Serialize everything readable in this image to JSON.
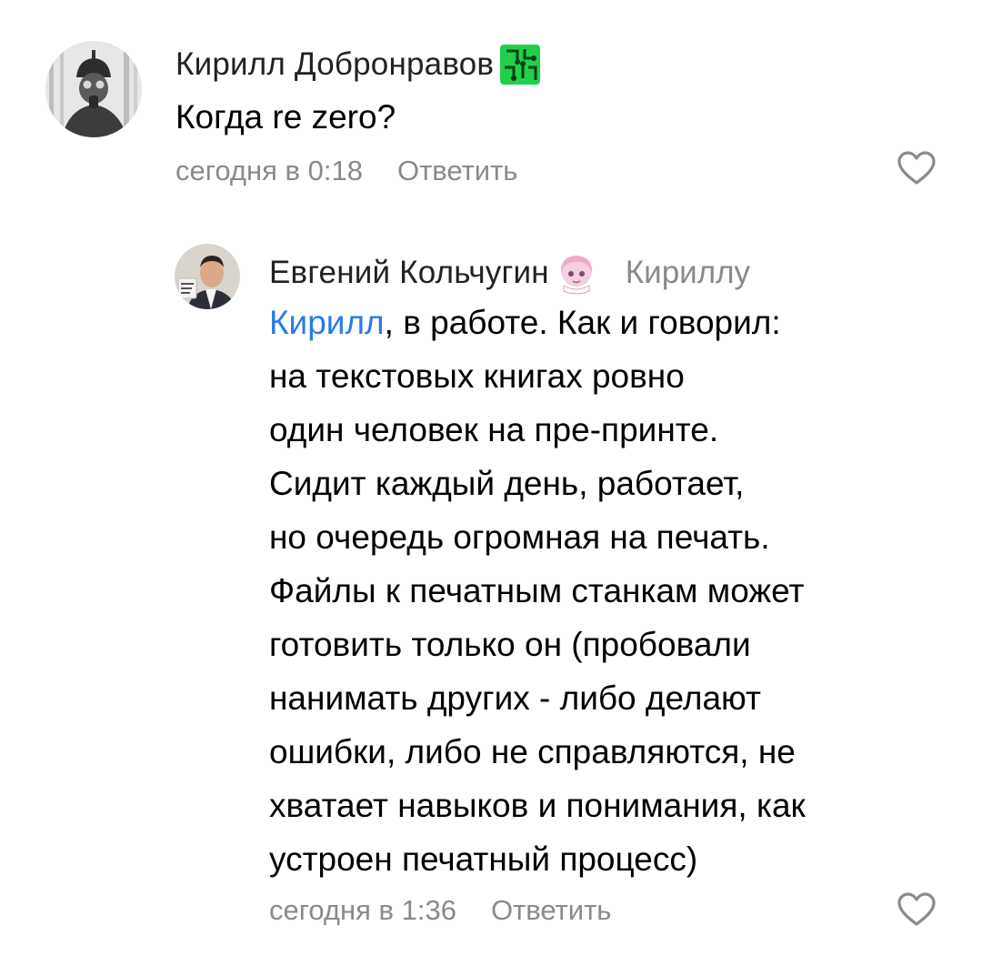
{
  "comments": [
    {
      "author": "Кирилл Добронравов",
      "badge_icon": "circuit-chip-icon",
      "text": "Когда re zero?",
      "timestamp": "сегодня в 0:18",
      "reply_label": "Ответить",
      "like_icon": "heart-outline-icon"
    },
    {
      "author": "Евгений Кольчугин",
      "badge_icon": "anime-girl-sticker-icon",
      "reply_to": "Кириллу",
      "mention": "Кирилл",
      "first_line_rest": ", в работе. Как и говорил:",
      "lines": [
        "на текстовых книгах ровно",
        "один человек на пре-принте.",
        "Сидит каждый день, работает,",
        "но очередь огромная на печать.",
        "Файлы к печатным станкам может",
        "готовить только он (пробовали",
        "нанимать других - либо делают",
        "ошибки, либо не справляются, не",
        "хватает навыков и понимания, как",
        "устроен печатный процесс)"
      ],
      "timestamp": "сегодня в 1:36",
      "reply_label": "Ответить",
      "like_icon": "heart-outline-icon"
    }
  ],
  "colors": {
    "mention": "#2a7be4",
    "meta_text": "#8a8a8a",
    "chip_badge": "#1fd14a"
  }
}
